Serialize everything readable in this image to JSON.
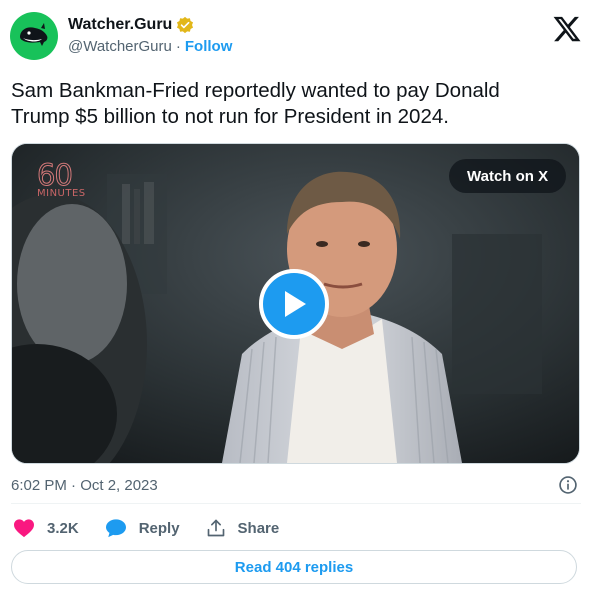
{
  "account": {
    "display_name": "Watcher.Guru",
    "handle": "@WatcherGuru",
    "separator": "·",
    "follow_label": "Follow"
  },
  "tweet": {
    "text": "Sam Bankman-Fried reportedly wanted to pay Donald\nTrump $5 billion to not run for President in 2024."
  },
  "media": {
    "watermark_number": "60",
    "watermark_text": "MINUTES",
    "watch_label": "Watch on X"
  },
  "meta": {
    "timestamp": "6:02 PM · Oct 2, 2023"
  },
  "actions": {
    "like_count": "3.2K",
    "reply_label": "Reply",
    "share_label": "Share"
  },
  "replies": {
    "label": "Read 404 replies"
  },
  "colors": {
    "accent": "#1d9bf0",
    "like": "#f91880",
    "avatar_bg": "#18c25a",
    "verified": "#e2b719"
  },
  "icons": [
    "whale-logo-icon",
    "verified-badge-icon",
    "x-logo-icon",
    "play-icon",
    "info-icon",
    "heart-icon",
    "reply-bubble-icon",
    "share-icon"
  ]
}
